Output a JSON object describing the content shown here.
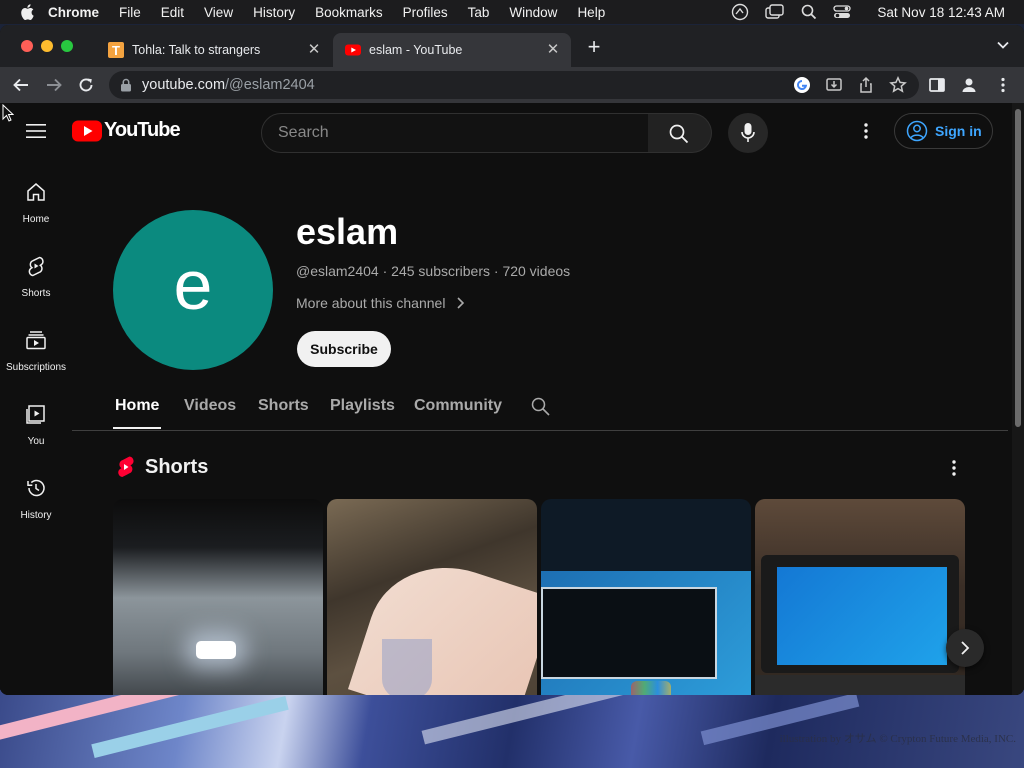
{
  "menubar": {
    "app": "Chrome",
    "items": [
      "File",
      "Edit",
      "View",
      "History",
      "Bookmarks",
      "Profiles",
      "Tab",
      "Window",
      "Help"
    ],
    "clock": "Sat Nov 18  12:43 AM"
  },
  "tabs": [
    {
      "title": "Tohla: Talk to strangers",
      "favicon": "letter-t-icon"
    },
    {
      "title": "eslam - YouTube",
      "favicon": "youtube-icon",
      "active": true
    }
  ],
  "omnibox": {
    "host": "youtube.com",
    "path": "/@eslam2404"
  },
  "youtube": {
    "logo_text": "YouTube",
    "search_placeholder": "Search",
    "sign_in": "Sign in",
    "nav": [
      {
        "label": "Home",
        "icon": "home-icon"
      },
      {
        "label": "Shorts",
        "icon": "shorts-icon"
      },
      {
        "label": "Subscriptions",
        "icon": "subscriptions-icon"
      },
      {
        "label": "You",
        "icon": "you-icon"
      },
      {
        "label": "History",
        "icon": "history-icon"
      }
    ],
    "channel": {
      "avatar_letter": "e",
      "avatar_color": "#0b8a7f",
      "name": "eslam",
      "handle": "@eslam2404",
      "subscribers": "245 subscribers",
      "videos": "720 videos",
      "more_about": "More about this channel",
      "subscribe": "Subscribe"
    },
    "channel_tabs": [
      "Home",
      "Videos",
      "Shorts",
      "Playlists",
      "Community"
    ],
    "active_tab": "Home",
    "section_title": "Shorts"
  },
  "wallpaper_credit": "illustration by オサム © Crypton Future Media, INC."
}
